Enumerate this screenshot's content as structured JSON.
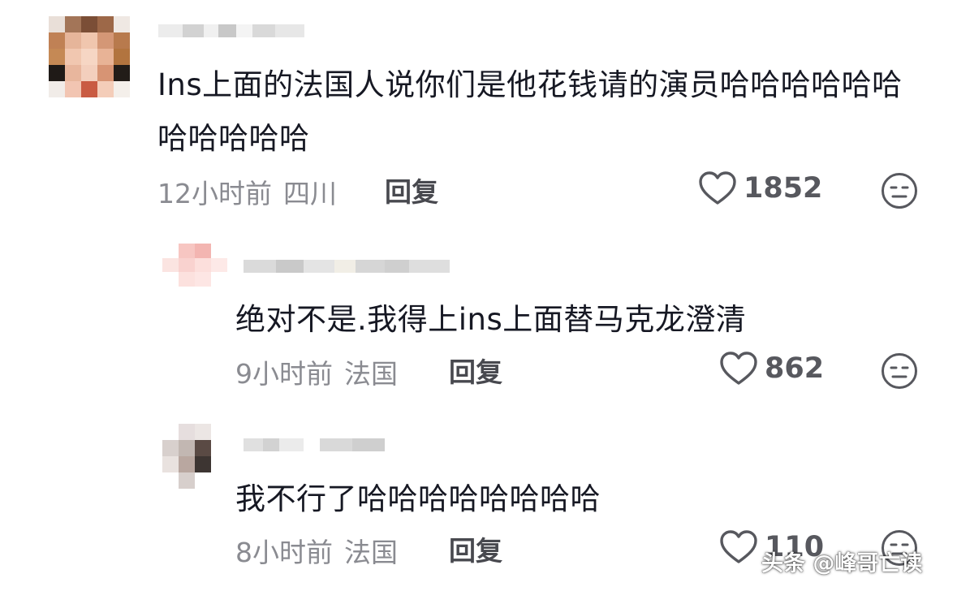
{
  "comments": [
    {
      "text": "Ins上面的法国人说你们是他花钱请的演员哈哈哈哈哈哈哈哈哈哈哈",
      "time": "12小时前",
      "location": "四川",
      "reply_label": "回复",
      "likes": "1852",
      "like_icon": "heart-outline-icon",
      "dislike_icon": "meh-face-icon"
    },
    {
      "text": "绝对不是.我得上ins上面替马克龙澄清",
      "time": "9小时前",
      "location": "法国",
      "reply_label": "回复",
      "likes": "862",
      "like_icon": "heart-outline-icon",
      "dislike_icon": "meh-face-icon"
    },
    {
      "text": "我不行了哈哈哈哈哈哈哈哈",
      "time": "8小时前",
      "location": "法国",
      "reply_label": "回复",
      "likes": "110",
      "like_icon": "heart-outline-icon",
      "dislike_icon": "meh-face-icon"
    }
  ],
  "watermark": "头条 @峰哥亡读",
  "colors": {
    "text": "#161823",
    "meta": "#8a8b91",
    "reply": "#48494f",
    "icon": "#57585e"
  }
}
